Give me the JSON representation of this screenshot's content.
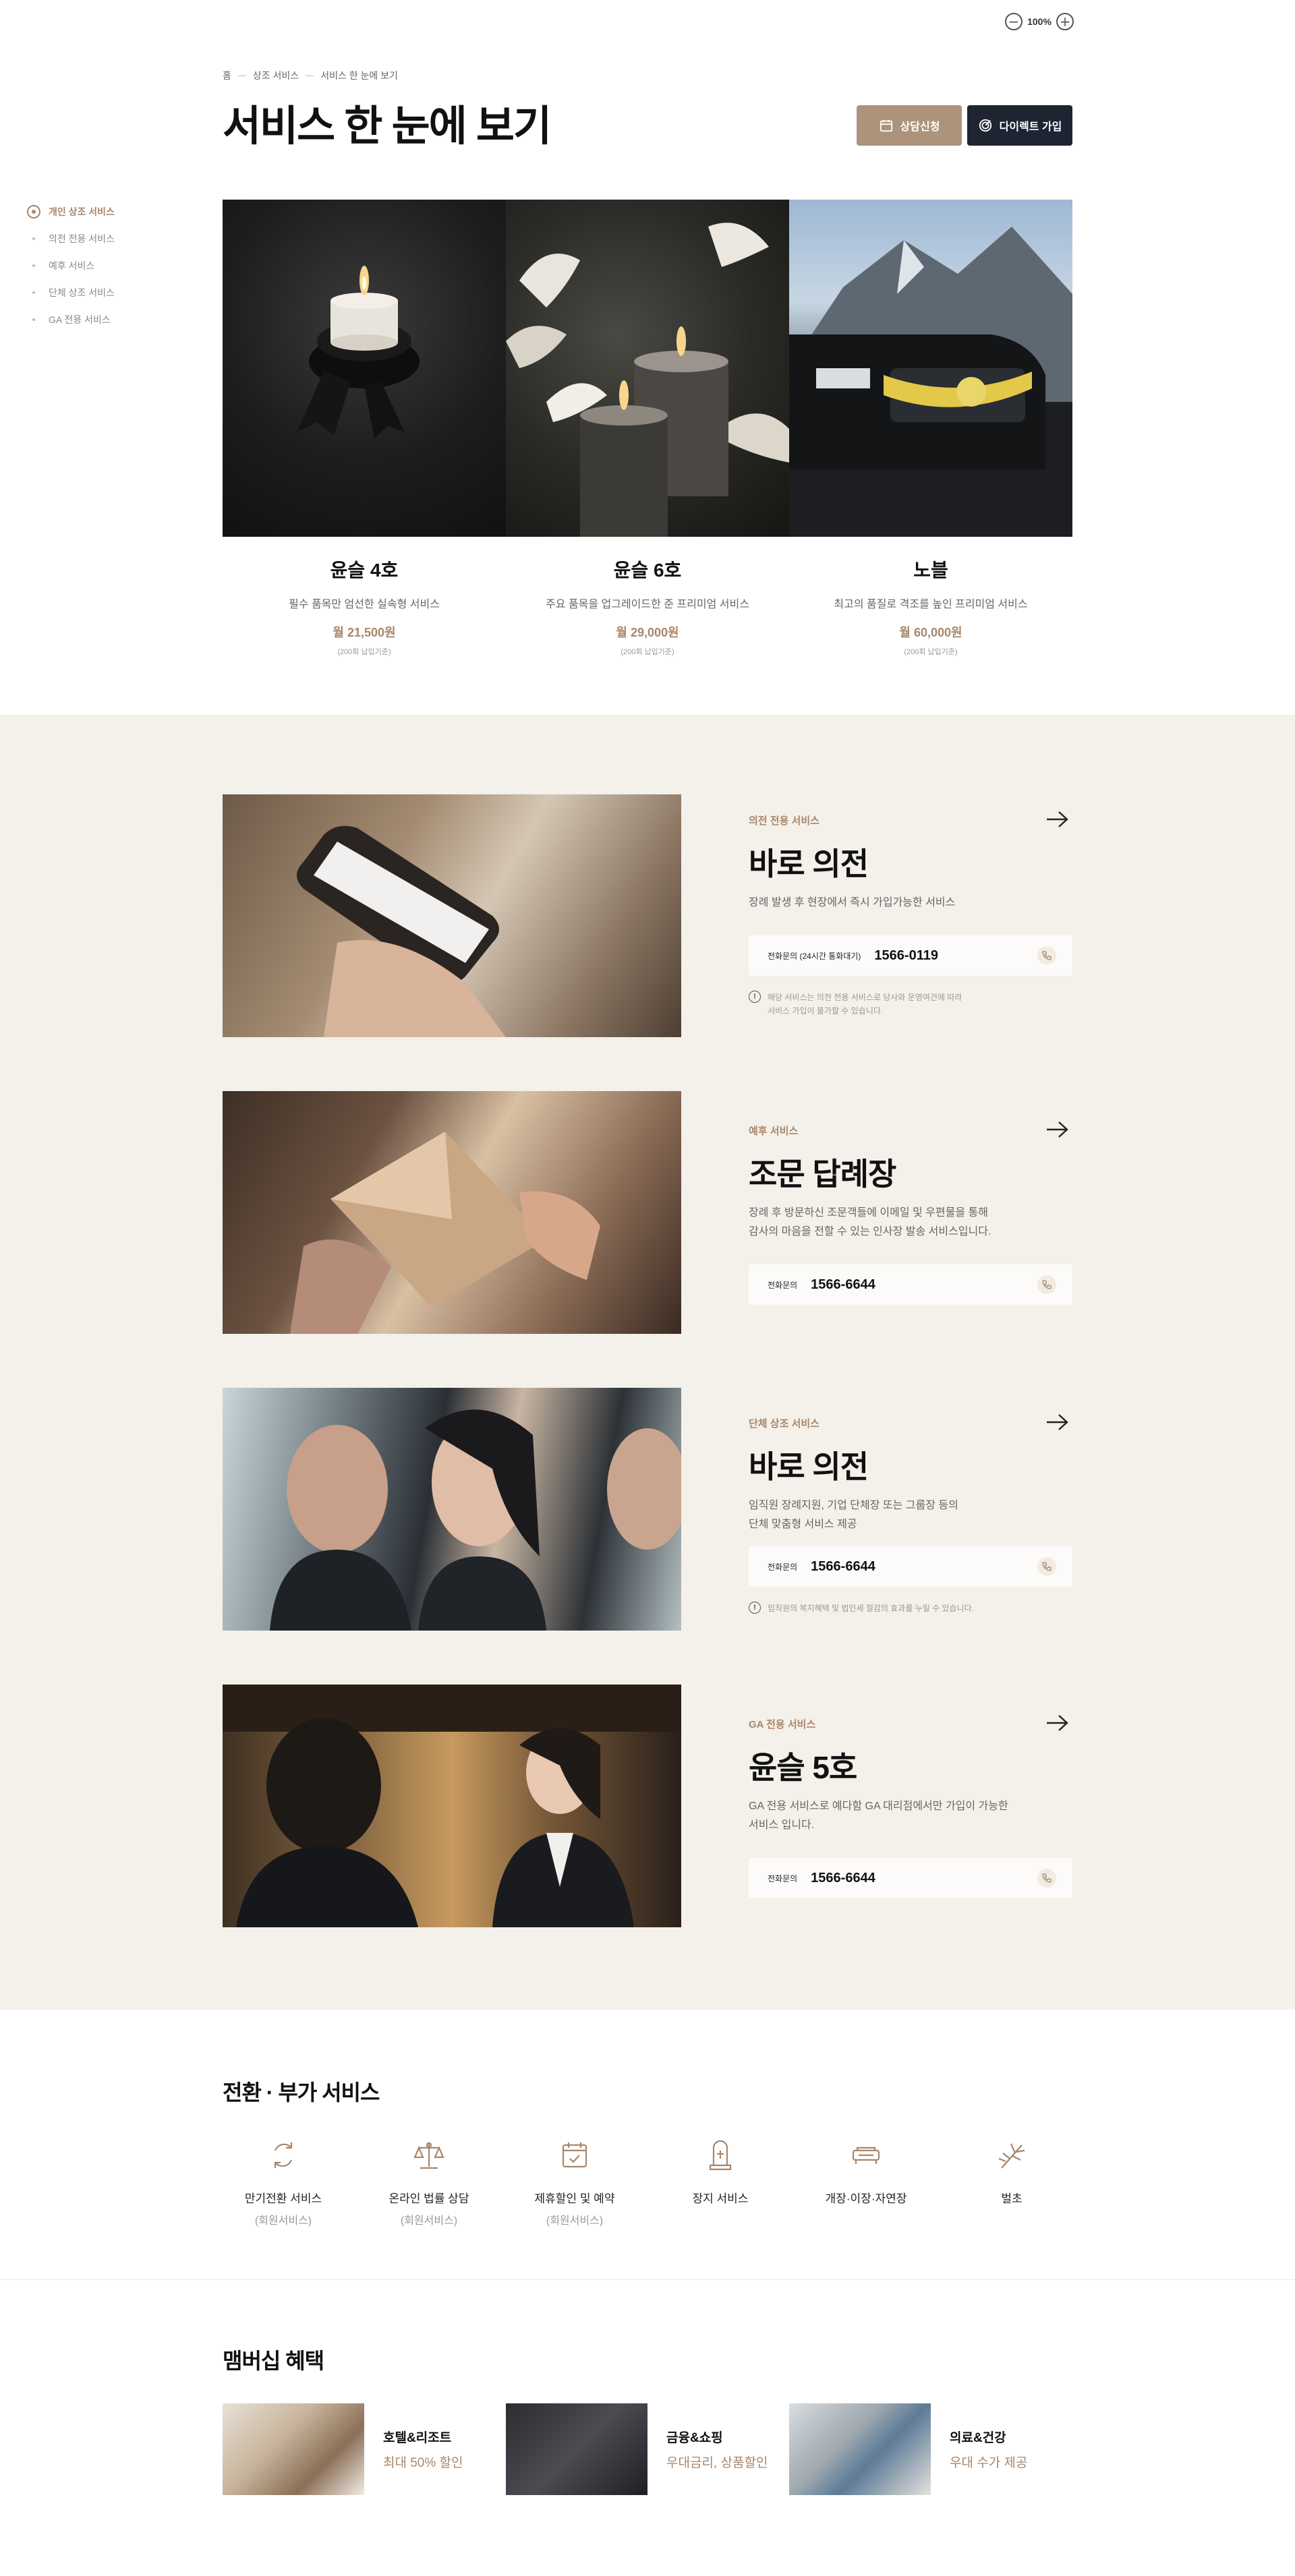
{
  "zoom": {
    "minus": "−",
    "value": "100%",
    "plus": "+"
  },
  "breadcrumb": [
    "홈",
    "상조 서비스",
    "서비스 한 눈에 보기"
  ],
  "page_title": "서비스 한 눈에 보기",
  "buttons": {
    "consult": "상담신청",
    "join": "다이렉트 가입"
  },
  "sidenav": [
    {
      "label": "개인 상조 서비스",
      "active": true
    },
    {
      "label": "의전 전용 서비스",
      "active": false
    },
    {
      "label": "예후 서비스",
      "active": false
    },
    {
      "label": "단체 상조 서비스",
      "active": false
    },
    {
      "label": "GA 전용 서비스",
      "active": false
    }
  ],
  "products": [
    {
      "name": "윤슬 4호",
      "desc": "필수 품목만 엄선한 실속형 서비스",
      "price": "월 21,500원",
      "note": "(200회 납입기준)"
    },
    {
      "name": "윤슬 6호",
      "desc": "주요 품목을 업그레이드한 준 프리미엄 서비스",
      "price": "월 29,000원",
      "note": "(200회 납입기준)"
    },
    {
      "name": "노블",
      "desc": "최고의 품질로 격조를 높인 프리미엄 서비스",
      "price": "월 60,000원",
      "note": "(200회 납입기준)"
    }
  ],
  "services": [
    {
      "category": "의전 전용 서비스",
      "title": "바로 의전",
      "desc": [
        "장례 발생 후 현장에서 즉시 가입가능한 서비스"
      ],
      "phone_label": "전화문의 (24시간 통화대기)",
      "phone": "1566-0119",
      "note": [
        "해당 서비스는 의전 전용 서비스로 당사와 운영여건에 따라",
        "서비스 가입이 불가할 수 있습니다."
      ]
    },
    {
      "category": "예후 서비스",
      "title": "조문 답례장",
      "desc": [
        "장례 후 방문하신 조문객들에 이메일 및 우편물을 통해",
        "감사의 마음을 전할 수 있는 인사장 발송 서비스입니다."
      ],
      "phone_label": "전화문의",
      "phone": "1566-6644",
      "note": []
    },
    {
      "category": "단체 상조 서비스",
      "title": "바로 의전",
      "desc": [
        "임직원 장례지원, 기업 단체장 또는 그룹장 등의",
        "단체 맞춤형 서비스 제공"
      ],
      "phone_label": "전화문의",
      "phone": "1566-6644",
      "note": [
        "임직원의 복지혜택 및 법인세 절감의 효과를 누릴 수 있습니다."
      ]
    },
    {
      "category": "GA 전용 서비스",
      "title": "윤슬 5호",
      "desc": [
        "GA 전용 서비스로 예다함 GA 대리점에서만 가입이 가능한",
        "서비스 입니다."
      ],
      "phone_label": "전화문의",
      "phone": "1566-6644",
      "note": []
    }
  ],
  "addons_title": "전환 · 부가 서비스",
  "addons": [
    {
      "name": "만기전환 서비스",
      "sub": "(회원서비스)",
      "icon": "cycle-icon"
    },
    {
      "name": "온라인 법률 상담",
      "sub": "(회원서비스)",
      "icon": "scale-icon"
    },
    {
      "name": "제휴할인 및 예약",
      "sub": "(회원서비스)",
      "icon": "calendar-check-icon"
    },
    {
      "name": "장지 서비스",
      "sub": "",
      "icon": "memorial-icon"
    },
    {
      "name": "개장·이장·자연장",
      "sub": "",
      "icon": "tomb-icon"
    },
    {
      "name": "벌초",
      "sub": "",
      "icon": "grass-icon"
    }
  ],
  "membership_title": "맴버십 혜택",
  "membership": [
    {
      "name": "호텔&리조트",
      "benefit": "최대 50% 할인"
    },
    {
      "name": "금융&쇼핑",
      "benefit": "우대금리, 상품할인"
    },
    {
      "name": "의료&건강",
      "benefit": "우대 수가 제공"
    }
  ],
  "colors": {
    "accent": "#a8866a",
    "navy": "#1f2433",
    "beige_bg": "#f4f0ea"
  }
}
